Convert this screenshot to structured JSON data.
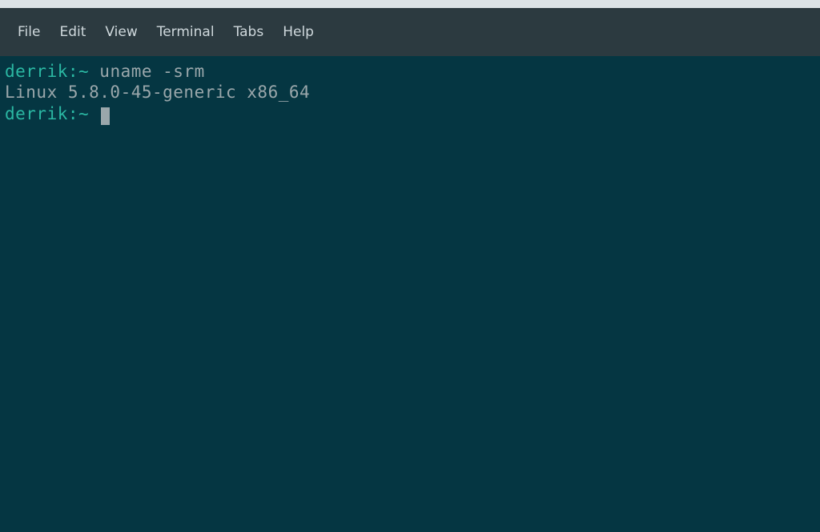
{
  "menubar": {
    "items": [
      {
        "label": "File"
      },
      {
        "label": "Edit"
      },
      {
        "label": "View"
      },
      {
        "label": "Terminal"
      },
      {
        "label": "Tabs"
      },
      {
        "label": "Help"
      }
    ]
  },
  "terminal": {
    "lines": [
      {
        "prompt": "derrik:~ ",
        "command": "uname -srm"
      },
      {
        "output": "Linux 5.8.0-45-generic x86_64"
      },
      {
        "prompt": "derrik:~ ",
        "cursor": true
      }
    ]
  }
}
